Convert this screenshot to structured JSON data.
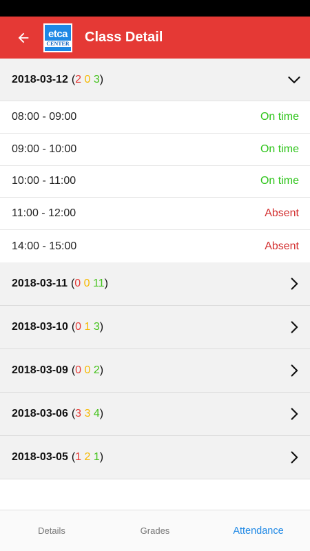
{
  "app_bar": {
    "title": "Class Detail",
    "logo_top": "etca",
    "logo_bottom": "CENTER",
    "back_icon": "arrow-left-icon",
    "color": "#e53935"
  },
  "colors": {
    "red": "#e53935",
    "yellow": "#f6b900",
    "green": "#43c21a",
    "active_tab": "#1e88e5"
  },
  "groups": [
    {
      "date": "2018-03-12",
      "counts": [
        "2",
        "0",
        "3"
      ],
      "expanded": true,
      "slots": [
        {
          "time": "08:00 - 09:00",
          "status": "On time"
        },
        {
          "time": "09:00 - 10:00",
          "status": "On time"
        },
        {
          "time": "10:00 - 11:00",
          "status": "On time"
        },
        {
          "time": "11:00 - 12:00",
          "status": "Absent"
        },
        {
          "time": "14:00 - 15:00",
          "status": "Absent"
        }
      ]
    },
    {
      "date": "2018-03-11",
      "counts": [
        "0",
        "0",
        "11"
      ],
      "expanded": false
    },
    {
      "date": "2018-03-10",
      "counts": [
        "0",
        "1",
        "3"
      ],
      "expanded": false
    },
    {
      "date": "2018-03-09",
      "counts": [
        "0",
        "0",
        "2"
      ],
      "expanded": false
    },
    {
      "date": "2018-03-06",
      "counts": [
        "3",
        "3",
        "4"
      ],
      "expanded": false
    },
    {
      "date": "2018-03-05",
      "counts": [
        "1",
        "2",
        "1"
      ],
      "expanded": false
    }
  ],
  "bottom_nav": {
    "tabs": [
      {
        "label": "Details",
        "active": false
      },
      {
        "label": "Grades",
        "active": false
      },
      {
        "label": "Attendance",
        "active": true
      }
    ]
  }
}
